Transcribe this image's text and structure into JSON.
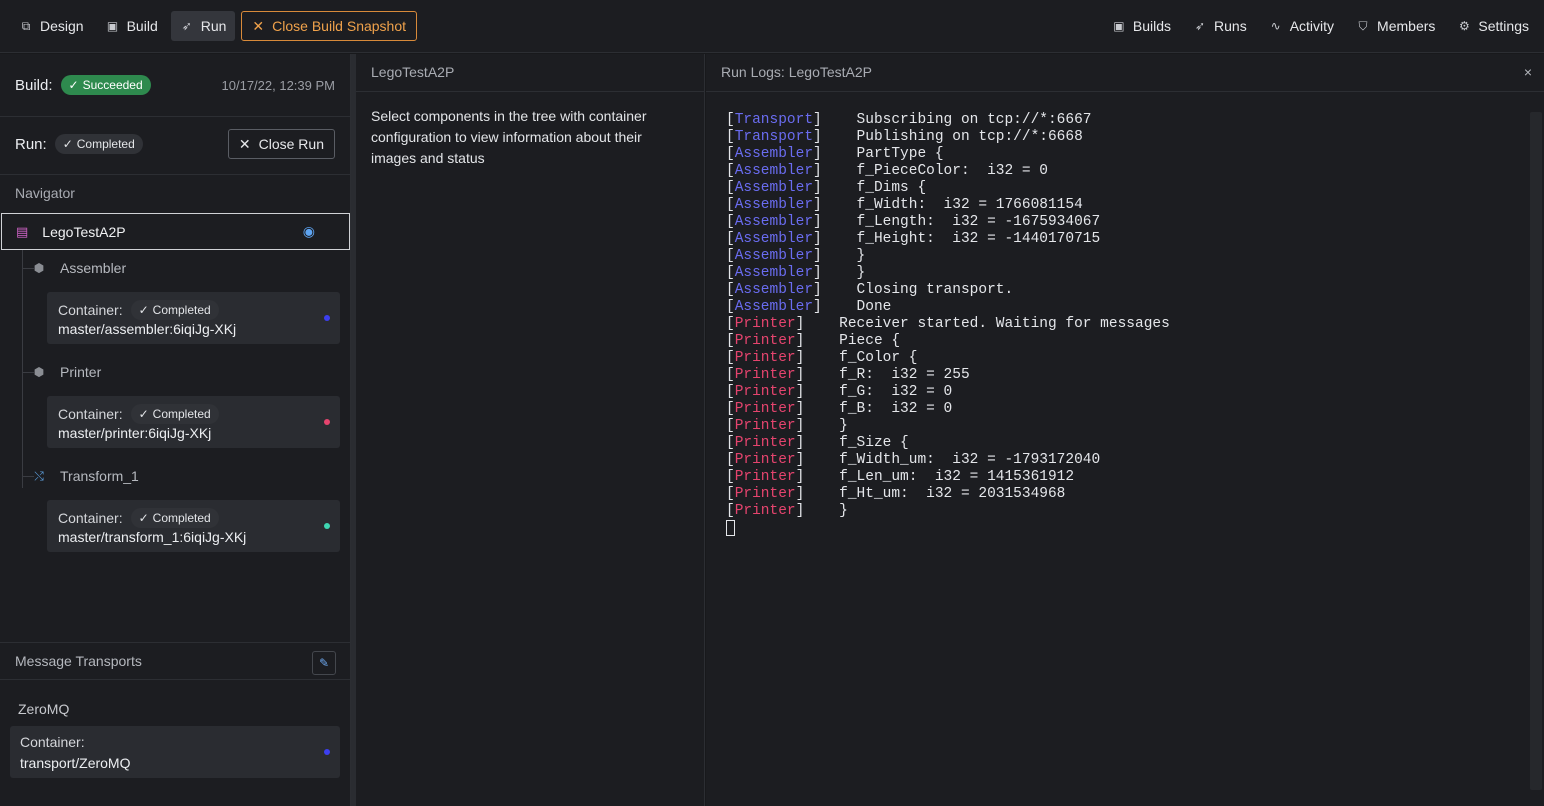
{
  "topbar": {
    "left": [
      {
        "label": "Design",
        "icon": "design-icon",
        "glyph": "⧉",
        "active": false
      },
      {
        "label": "Build",
        "icon": "terminal-icon",
        "glyph": "▣",
        "active": false
      },
      {
        "label": "Run",
        "icon": "rocket-icon",
        "glyph": "➶",
        "active": true
      }
    ],
    "snapshot_label": "Close Build Snapshot",
    "right": [
      {
        "label": "Builds",
        "icon": "terminal-icon",
        "glyph": "▣"
      },
      {
        "label": "Runs",
        "icon": "rocket-icon",
        "glyph": "➶"
      },
      {
        "label": "Activity",
        "icon": "activity-icon",
        "glyph": "∿"
      },
      {
        "label": "Members",
        "icon": "shield-icon",
        "glyph": "⛉"
      },
      {
        "label": "Settings",
        "icon": "gear-icon",
        "glyph": "⚙"
      }
    ]
  },
  "left": {
    "build_label": "Build:",
    "build_status": "Succeeded",
    "build_time": "10/17/22, 12:39 PM",
    "run_label": "Run:",
    "run_status": "Completed",
    "close_run_label": "Close Run",
    "navigator_title": "Navigator",
    "root_name": "LegoTestA2P",
    "nodes": [
      {
        "name": "Assembler",
        "container_label": "Container:",
        "status": "Completed",
        "image": "master/assembler:6iqiJg-XKj",
        "dot_color": "#3c3ff0"
      },
      {
        "name": "Printer",
        "container_label": "Container:",
        "status": "Completed",
        "image": "master/printer:6iqiJg-XKj",
        "dot_color": "#e5446e"
      },
      {
        "name": "Transform_1",
        "container_label": "Container:",
        "status": "Completed",
        "image": "master/transform_1:6iqiJg-XKj",
        "dot_color": "#3fd6b2"
      }
    ],
    "transports_title": "Message Transports",
    "zmq_title": "ZeroMQ",
    "zmq_container_label": "Container:",
    "zmq_image": "transport/ZeroMQ",
    "zmq_dot_color": "#3c3ff0"
  },
  "middle": {
    "title": "LegoTestA2P",
    "text": "Select components in the tree with container configuration to view information about their images and status"
  },
  "right": {
    "title": "Run Logs: LegoTestA2P",
    "close_glyph": "×",
    "logs": [
      {
        "src": "Transport",
        "kind": "t",
        "pad": "    ",
        "msg": "Subscribing on tcp://*:6667"
      },
      {
        "src": "Transport",
        "kind": "t",
        "pad": "    ",
        "msg": "Publishing on tcp://*:6668"
      },
      {
        "src": "Assembler",
        "kind": "a",
        "pad": "    ",
        "msg": "PartType {"
      },
      {
        "src": "Assembler",
        "kind": "a",
        "pad": "    ",
        "msg": "f_PieceColor:  i32 = 0"
      },
      {
        "src": "Assembler",
        "kind": "a",
        "pad": "    ",
        "msg": "f_Dims {"
      },
      {
        "src": "Assembler",
        "kind": "a",
        "pad": "    ",
        "msg": "f_Width:  i32 = 1766081154"
      },
      {
        "src": "Assembler",
        "kind": "a",
        "pad": "    ",
        "msg": "f_Length:  i32 = -1675934067"
      },
      {
        "src": "Assembler",
        "kind": "a",
        "pad": "    ",
        "msg": "f_Height:  i32 = -1440170715"
      },
      {
        "src": "Assembler",
        "kind": "a",
        "pad": "    ",
        "msg": "}"
      },
      {
        "src": "Assembler",
        "kind": "a",
        "pad": "    ",
        "msg": "}"
      },
      {
        "src": "Assembler",
        "kind": "a",
        "pad": "    ",
        "msg": "Closing transport."
      },
      {
        "src": "Assembler",
        "kind": "a",
        "pad": "    ",
        "msg": "Done"
      },
      {
        "src": "Printer",
        "kind": "p",
        "pad": "    ",
        "msg": "Receiver started. Waiting for messages"
      },
      {
        "src": "Printer",
        "kind": "p",
        "pad": "    ",
        "msg": "Piece {"
      },
      {
        "src": "Printer",
        "kind": "p",
        "pad": "    ",
        "msg": "f_Color {"
      },
      {
        "src": "Printer",
        "kind": "p",
        "pad": "    ",
        "msg": "f_R:  i32 = 255"
      },
      {
        "src": "Printer",
        "kind": "p",
        "pad": "    ",
        "msg": "f_G:  i32 = 0"
      },
      {
        "src": "Printer",
        "kind": "p",
        "pad": "    ",
        "msg": "f_B:  i32 = 0"
      },
      {
        "src": "Printer",
        "kind": "p",
        "pad": "    ",
        "msg": "}"
      },
      {
        "src": "Printer",
        "kind": "p",
        "pad": "    ",
        "msg": "f_Size {"
      },
      {
        "src": "Printer",
        "kind": "p",
        "pad": "    ",
        "msg": "f_Width_um:  i32 = -1793172040"
      },
      {
        "src": "Printer",
        "kind": "p",
        "pad": "    ",
        "msg": "f_Len_um:  i32 = 1415361912"
      },
      {
        "src": "Printer",
        "kind": "p",
        "pad": "    ",
        "msg": "f_Ht_um:  i32 = 2031534968"
      },
      {
        "src": "Printer",
        "kind": "p",
        "pad": "    ",
        "msg": "}"
      }
    ]
  }
}
